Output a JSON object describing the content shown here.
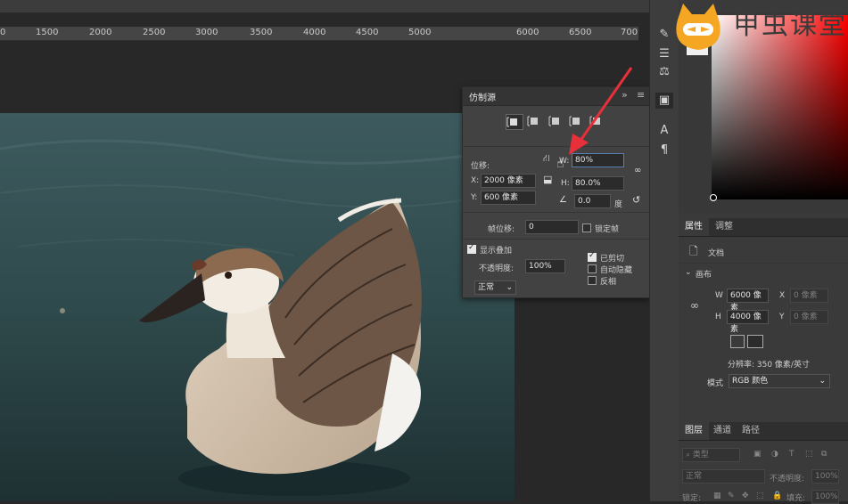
{
  "ruler": {
    "ticks": [
      "1500",
      "2000",
      "2500",
      "3000",
      "3500",
      "4000",
      "4500",
      "5000",
      "6000",
      "6500",
      "700"
    ]
  },
  "clone_source": {
    "title": "仿制源",
    "offset_label": "位移:",
    "x_label": "X:",
    "x_value": "2000 像素",
    "y_label": "Y:",
    "y_value": "600 像素",
    "w_label": "W:",
    "w_value": "80%",
    "h_label": "H:",
    "h_value": "80.0%",
    "angle_value": "0.0",
    "angle_unit": "度",
    "frame_offset_label": "帧位移:",
    "frame_offset_value": "0",
    "lock_frame_label": "锁定帧",
    "show_overlay_label": "显示叠加",
    "opacity_label": "不透明度:",
    "opacity_value": "100%",
    "clipped_label": "已剪切",
    "auto_hide_label": "自动隐藏",
    "invert_label": "反相",
    "blend_mode": "正常",
    "collapse_icon": "double-chevron-right-icon",
    "menu_icon": "panel-menu-icon"
  },
  "properties": {
    "tabs": [
      "属性",
      "调整"
    ],
    "doc_label": "文档",
    "canvas_section": "画布",
    "w_label": "W",
    "w_value": "6000 像素",
    "h_label": "H",
    "h_value": "4000 像素",
    "x_label": "X",
    "x_placeholder": "0 像素",
    "y_label": "Y",
    "y_placeholder": "0 像素",
    "resolution": "分辨率: 350 像素/英寸",
    "mode_label": "模式",
    "mode_value": "RGB 颜色"
  },
  "layers": {
    "tabs": [
      "图层",
      "通道",
      "路径"
    ],
    "kind_placeholder": "类型",
    "blend_mode": "正常",
    "opacity_label": "不透明度:",
    "opacity_value": "100%",
    "lock_label": "锁定:",
    "fill_label": "填充:",
    "fill_value": "100%"
  },
  "watermark": {
    "text": "甲虫课堂"
  },
  "colors": {
    "accent_arrow": "#e8303a",
    "logo": "#f5a623",
    "panel_bg": "#424242"
  }
}
